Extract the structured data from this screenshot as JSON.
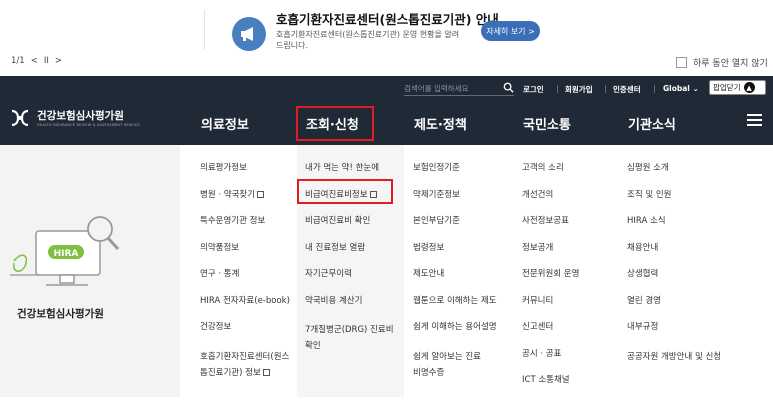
{
  "popup": {
    "title": "호흡기환자진료센터(원스톱진료기관) 안내",
    "description": "호흡기환자진료센터(원스톱진료기관) 운영 현황을 알려드립니다.",
    "detail_button": "자세히 보기 >",
    "pager_text": "1/1",
    "prev": "<",
    "pause": "II",
    "next": ">",
    "dont_show_label": "하루 동안 열지 않기"
  },
  "utility": {
    "search_placeholder": "검색어를 입력하세요",
    "login": "로그인",
    "signup": "회원가입",
    "certification": "인증센터",
    "global": "Global",
    "popup_close": "팝업닫기"
  },
  "logo": {
    "name": "건강보험심사평가원",
    "subtitle": "HEALTH INSURANCE REVIEW & ASSESSMENT SERVICE"
  },
  "nav": [
    "의료정보",
    "조회·신청",
    "제도·정책",
    "국민소통",
    "기관소식"
  ],
  "mega_left": {
    "badge": "HIRA",
    "name": "건강보험심사평가원"
  },
  "columns": [
    [
      "의료평가정보",
      "병원 · 약국찾기",
      "특수운영기관 정보",
      "의약품정보",
      "연구 · 통계",
      "HIRA 전자자료(e-book)",
      "건강정보",
      "호흡기환자진료센터(원스톱진료기관) 정보"
    ],
    [
      "내가 먹는 약! 한눈에",
      "비급여진료비정보",
      "비급여진료비 확인",
      "내 진료정보 열람",
      "자기근무이력",
      "약국비용 계산기",
      "7개질병군(DRG) 진료비 확인"
    ],
    [
      "보험인정기준",
      "약제기준정보",
      "본인부담기준",
      "법령정보",
      "제도안내",
      "웹툰으로 이해하는 제도",
      "쉽게 이해하는 용어설명",
      "쉽게 알아보는 진료비명수증"
    ],
    [
      "고객의 소리",
      "개선건의",
      "사전정보공표",
      "정보공개",
      "전문위원회 운영",
      "커뮤니티",
      "신고센터",
      "공시 · 공표",
      "ICT 소통채널"
    ],
    [
      "심평원 소개",
      "조직 및 인원",
      "HIRA 소식",
      "채용안내",
      "상생협력",
      "열린 경영",
      "내부규정",
      "공공자원 개방안내 및 신청"
    ]
  ],
  "colors": {
    "header_bg": "#1f2a36",
    "highlight": "#e31b23",
    "accent_blue": "#3a6fb8"
  }
}
